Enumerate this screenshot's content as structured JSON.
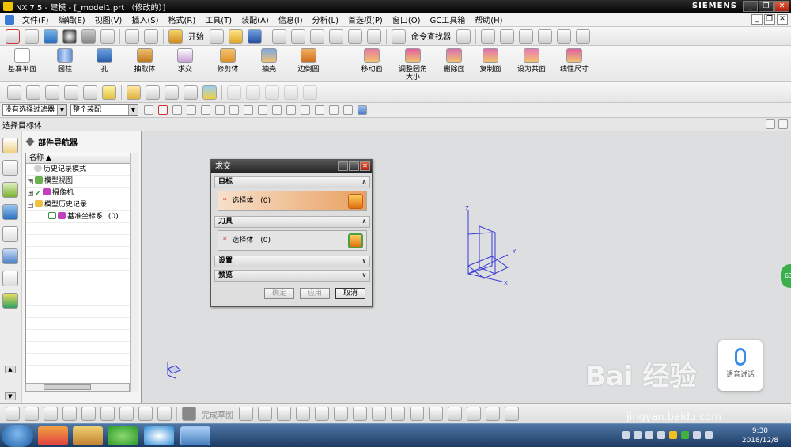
{
  "window": {
    "title": "NX 7.5 - 建模 - [_model1.prt （修改的）]",
    "brand": "SIEMENS"
  },
  "menubar": {
    "items": [
      "文件(F)",
      "编辑(E)",
      "视图(V)",
      "插入(S)",
      "格式(R)",
      "工具(T)",
      "装配(A)",
      "信息(I)",
      "分析(L)",
      "首选项(P)",
      "窗口(O)",
      "GC工具箱",
      "帮助(H)"
    ]
  },
  "toolbar1": {
    "start_label": "开始",
    "command_finder_label": "命令查找器"
  },
  "toolbar2": {
    "tools": [
      "基准平面",
      "圆柱",
      "孔",
      "抽取体",
      "求交",
      "修剪体",
      "抽壳",
      "边倒圆",
      "移动面",
      "调整圆角大小",
      "删除面",
      "复制面",
      "设为共面",
      "线性尺寸"
    ]
  },
  "filterbar": {
    "filter_value": "没有选择过滤器",
    "scope_value": "整个装配"
  },
  "cuebar": {
    "text": "选择目标体"
  },
  "navigator": {
    "title": "部件导航器",
    "column_header": "名称",
    "rows": [
      {
        "label": "历史记录模式"
      },
      {
        "label": "模型视图"
      },
      {
        "label": "摄像机"
      },
      {
        "label": "模型历史记录"
      },
      {
        "label": "基准坐标系",
        "count": "(0)"
      }
    ]
  },
  "dialog": {
    "title": "求交",
    "target_section": "目标",
    "target_select_label": "选择体",
    "target_select_count": "(0)",
    "tool_section": "刀具",
    "tool_select_label": "选择体",
    "tool_select_count": "(0)",
    "settings_section": "设置",
    "preview_section": "预览",
    "ok_label": "确定",
    "apply_label": "应用",
    "cancel_label": "取消"
  },
  "bottombar": {
    "sketch_label": "完成草图"
  },
  "taskbar": {
    "time": "9:30",
    "date": "2018/12/8"
  },
  "overlay": {
    "voice_label": "语音说话",
    "bubble_label": "63",
    "watermark": "Bai 经验",
    "watermark_url": "jingyan.baidu.com"
  },
  "colors": {
    "accent_orange": "#e8a060",
    "title_dark": "#1a1a1a",
    "graphics_bg": "#dcdedf",
    "axis_blue": "#3a3ad8"
  }
}
